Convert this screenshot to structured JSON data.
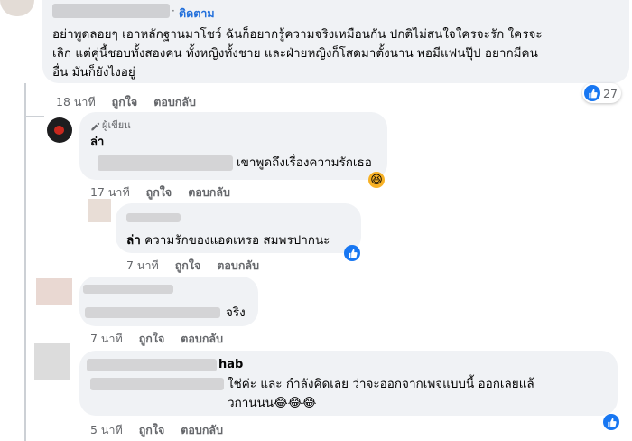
{
  "comment1": {
    "follow_label": "ติดตาม",
    "line1": "อย่าพูดลอยๆ เอาหลักฐานมาโชว์ ฉันก็อยากรู้ความจริงเหมือนกัน ปกติไม่สนใจใครจะรัก ใครจะ",
    "line2": "เลิก แต่คู่นี้ชอบทั้งสองคน ทั้งหญิงทั้งชาย และฝ่ายหญิงก็โสดมาตั้งนาน พอมีแฟนปุ๊ป อยากมีคน",
    "line3": "อื่น มันก็ยังไงอยู่",
    "time": "18 นาที",
    "like_label": "ถูกใจ",
    "reply_label": "ตอบกลับ",
    "reaction_count": "27"
  },
  "comment2": {
    "author_badge": "ผู้เขียน",
    "name": "ล่า",
    "text_tail": "เขาพูดถึงเรื่องความรักเธอ",
    "time": "17 นาที",
    "like_label": "ถูกใจ",
    "reply_label": "ตอบกลับ"
  },
  "comment3": {
    "tag": "ล่า",
    "text": "ความรักของแอดเหรอ สมพรปากนะ",
    "time": "7 นาที",
    "like_label": "ถูกใจ",
    "reply_label": "ตอบกลับ"
  },
  "comment4": {
    "text_tail": "จริง",
    "time": "7 นาที",
    "like_label": "ถูกใจ",
    "reply_label": "ตอบกลับ"
  },
  "comment5": {
    "name_tail": "hab",
    "line1": "ใช่ค่ะ และ กำลังคิดเลย ว่าจะออกจากเพจแบบนี้ ออกเลยแล้",
    "line2": "วกานนน😂😂😂",
    "time": "5 นาที",
    "like_label": "ถูกใจ",
    "reply_label": "ตอบกลับ"
  },
  "icons": {
    "like": "like-icon",
    "haha": "haha-icon",
    "pencil": "pencil-icon"
  },
  "colors": {
    "bubble": "#f0f2f5",
    "follow": "#216fdb",
    "like_blue": "#1877f2",
    "meta": "#65676b"
  }
}
